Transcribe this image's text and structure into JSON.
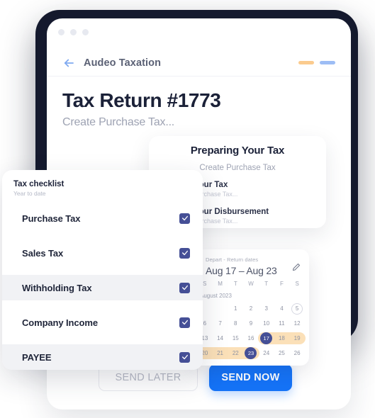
{
  "window": {
    "traffic_lights": [
      "dot-1",
      "dot-2",
      "dot-3"
    ],
    "back_icon": "arrow-left-icon",
    "app_title": "Audeo Taxation",
    "indicator_orange": "",
    "indicator_blue": ""
  },
  "page": {
    "title": "Tax Return #1773",
    "subtitle": "Create Purchase Tax..."
  },
  "prep_card": {
    "title": "Preparing Your Tax",
    "subtitle": "Create Purchase Tax",
    "rows": [
      {
        "title": "Save Your Tax",
        "subtitle": "Create Purchase Tax..."
      },
      {
        "title": "Save Your Disbursement",
        "subtitle": "Create Purchase Tax..."
      }
    ]
  },
  "calendar": {
    "label": "Depart - Return dates",
    "range": "Aug 17 – Aug 23",
    "edit_icon": "pencil-icon",
    "month": "August 2023",
    "dow": [
      "S",
      "M",
      "T",
      "W",
      "T",
      "F",
      "S"
    ],
    "weeks": [
      [
        "",
        "",
        "1",
        "2",
        "3",
        "4",
        "5"
      ],
      [
        "6",
        "7",
        "8",
        "9",
        "10",
        "11",
        "12"
      ],
      [
        "13",
        "14",
        "15",
        "16",
        "17",
        "18",
        "19"
      ],
      [
        "20",
        "21",
        "22",
        "23",
        "24",
        "25",
        "26"
      ]
    ],
    "today": "5",
    "selected": [
      "17",
      "23"
    ],
    "range_days": [
      "17",
      "18",
      "19",
      "20",
      "21",
      "22",
      "23"
    ],
    "accent": "#454f96",
    "range_color": "#fbe0b8"
  },
  "checklist": {
    "title": "Tax checklist",
    "subtitle": "Year to date",
    "items": [
      {
        "label": "Purchase Tax",
        "checked": true,
        "highlighted": false
      },
      {
        "label": "Sales Tax",
        "checked": true,
        "highlighted": false
      },
      {
        "label": "Withholding Tax",
        "checked": true,
        "highlighted": true
      },
      {
        "label": "Company Income",
        "checked": true,
        "highlighted": false
      },
      {
        "label": "PAYEE",
        "checked": true,
        "highlighted": true
      }
    ],
    "check_icon": "check-icon"
  },
  "footer": {
    "send_later": "SEND LATER",
    "send_now": "SEND NOW",
    "primary_color": "#1573f7"
  }
}
